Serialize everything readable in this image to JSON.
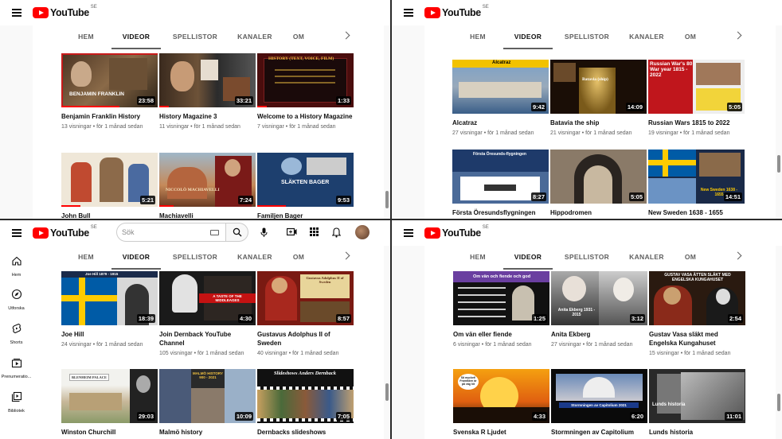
{
  "brand": {
    "name": "YouTube",
    "region": "SE"
  },
  "tabs": [
    "HEM",
    "VIDEOR",
    "SPELLISTOR",
    "KANALER",
    "OM"
  ],
  "active_tab": "VIDEOR",
  "search": {
    "placeholder": "Sök"
  },
  "sidebar": [
    {
      "icon": "home-icon",
      "label": "Hem"
    },
    {
      "icon": "explore-icon",
      "label": "Utforska"
    },
    {
      "icon": "shorts-icon",
      "label": "Shorts"
    },
    {
      "icon": "subscriptions-icon",
      "label": "Prenumeratio..."
    },
    {
      "icon": "library-icon",
      "label": "Bibliotek"
    }
  ],
  "panes": [
    {
      "videos": [
        {
          "title": "Benjamin Franklin History",
          "meta": "13 visningar • för 1 månad sedan",
          "duration": "23:58",
          "thumb_text": "BENJAMIN FRANKLIN",
          "progress": 0.6
        },
        {
          "title": "History Magazine 3",
          "meta": "11 visningar • för 1 månad sedan",
          "duration": "33:21",
          "thumb_text": "",
          "progress": 0.1
        },
        {
          "title": "Welcome to a History Magazine",
          "meta": "7 visningar • för 1 månad sedan",
          "duration": "1:33",
          "thumb_text": "HISTORY (TEXT, VOICE, FILM)",
          "progress": 0.1
        },
        {
          "title": "John Bull",
          "meta": "",
          "duration": "5:21",
          "thumb_text": "",
          "progress": 0.2
        },
        {
          "title": "Machiavelli",
          "meta": "",
          "duration": "7:24",
          "thumb_text": "NICCOLÒ MACHIAVELLI",
          "progress": 0.15
        },
        {
          "title": "Familjen Bager",
          "meta": "",
          "duration": "9:53",
          "thumb_text": "SLÄKTEN BAGER",
          "progress": 0.3
        }
      ]
    },
    {
      "videos": [
        {
          "title": "Alcatraz",
          "meta": "27 visningar • för 1 månad sedan",
          "duration": "9:42",
          "thumb_text": "Alcatraz",
          "progress": 0
        },
        {
          "title": "Batavia the ship",
          "meta": "21 visningar • för 1 månad sedan",
          "duration": "14:09",
          "thumb_text": "Batavia (ship)",
          "progress": 0
        },
        {
          "title": "Russian Wars 1815 to 2022",
          "meta": "19 visningar • för 1 månad sedan",
          "duration": "5:05",
          "thumb_text": "Russian War's 80 War year 1815 - 2022",
          "progress": 0
        },
        {
          "title": "Första Öresundsflygningen",
          "meta": "",
          "duration": "8:27",
          "thumb_text": "Första Öresunds-flygningen",
          "progress": 0
        },
        {
          "title": "Hippodromen",
          "meta": "",
          "duration": "5:05",
          "thumb_text": "",
          "progress": 0
        },
        {
          "title": "New Sweden 1638 - 1655",
          "meta": "",
          "duration": "14:51",
          "thumb_text": "New Sweden 1638 - 1655",
          "progress": 0
        }
      ]
    },
    {
      "videos": [
        {
          "title": "Joe Hill",
          "meta": "24 visningar • för 1 månad sedan",
          "duration": "18:39",
          "thumb_text": "Joe Hill 1879 - 1915",
          "progress": 0
        },
        {
          "title": "Join Dernback YouTube Channel",
          "meta": "105 visningar • för 1 månad sedan",
          "duration": "4:30",
          "thumb_text": "A TASTE OF THE MIDDLEAGES",
          "progress": 0
        },
        {
          "title": "Gustavus Adolphus II of Sweden",
          "meta": "40 visningar • för 1 månad sedan",
          "duration": "8:57",
          "thumb_text": "Gustavus Adolphus II of Sweden",
          "progress": 0
        },
        {
          "title": "Winston Churchill",
          "meta": "",
          "duration": "29:03",
          "thumb_text": "BLENHEIM PALACE",
          "progress": 0
        },
        {
          "title": "Malmö history",
          "meta": "",
          "duration": "10:09",
          "thumb_text": "MALMÖ HISTORY 900 - 2021",
          "progress": 0
        },
        {
          "title": "Dernbacks slideshows",
          "meta": "",
          "duration": "7:05",
          "thumb_text": "Slideshows Anders Dernback",
          "progress": 0
        }
      ]
    },
    {
      "videos": [
        {
          "title": "Om vän eller fiende",
          "meta": "6 visningar • för 1 månad sedan",
          "duration": "1:25",
          "thumb_text": "Om vän och fiende och god",
          "progress": 0
        },
        {
          "title": "Anita Ekberg",
          "meta": "27 visningar • för 1 månad sedan",
          "duration": "3:12",
          "thumb_text": "Anita Ekberg 1931 - 2015",
          "progress": 0
        },
        {
          "title": "Gustav Vasa släkt med Engelska Kungahuset",
          "meta": "15 visningar • för 1 månad sedan",
          "duration": "2:54",
          "thumb_text": "GUSTAV VASA ÄTTEN SLÄKT MED ENGELSKA KUNGAHUSET",
          "progress": 0
        },
        {
          "title": "Svenska R Ljudet",
          "meta": "",
          "duration": "4:33",
          "thumb_text": "Så mycket! Framtiden är på väg hit",
          "progress": 0
        },
        {
          "title": "Stormningen av Capitolium",
          "meta": "",
          "duration": "6:20",
          "thumb_text": "Stormningen av Capitolium 2021",
          "progress": 0
        },
        {
          "title": "Lunds historia",
          "meta": "",
          "duration": "11:01",
          "thumb_text": "Lunds historia",
          "progress": 0
        }
      ]
    }
  ]
}
